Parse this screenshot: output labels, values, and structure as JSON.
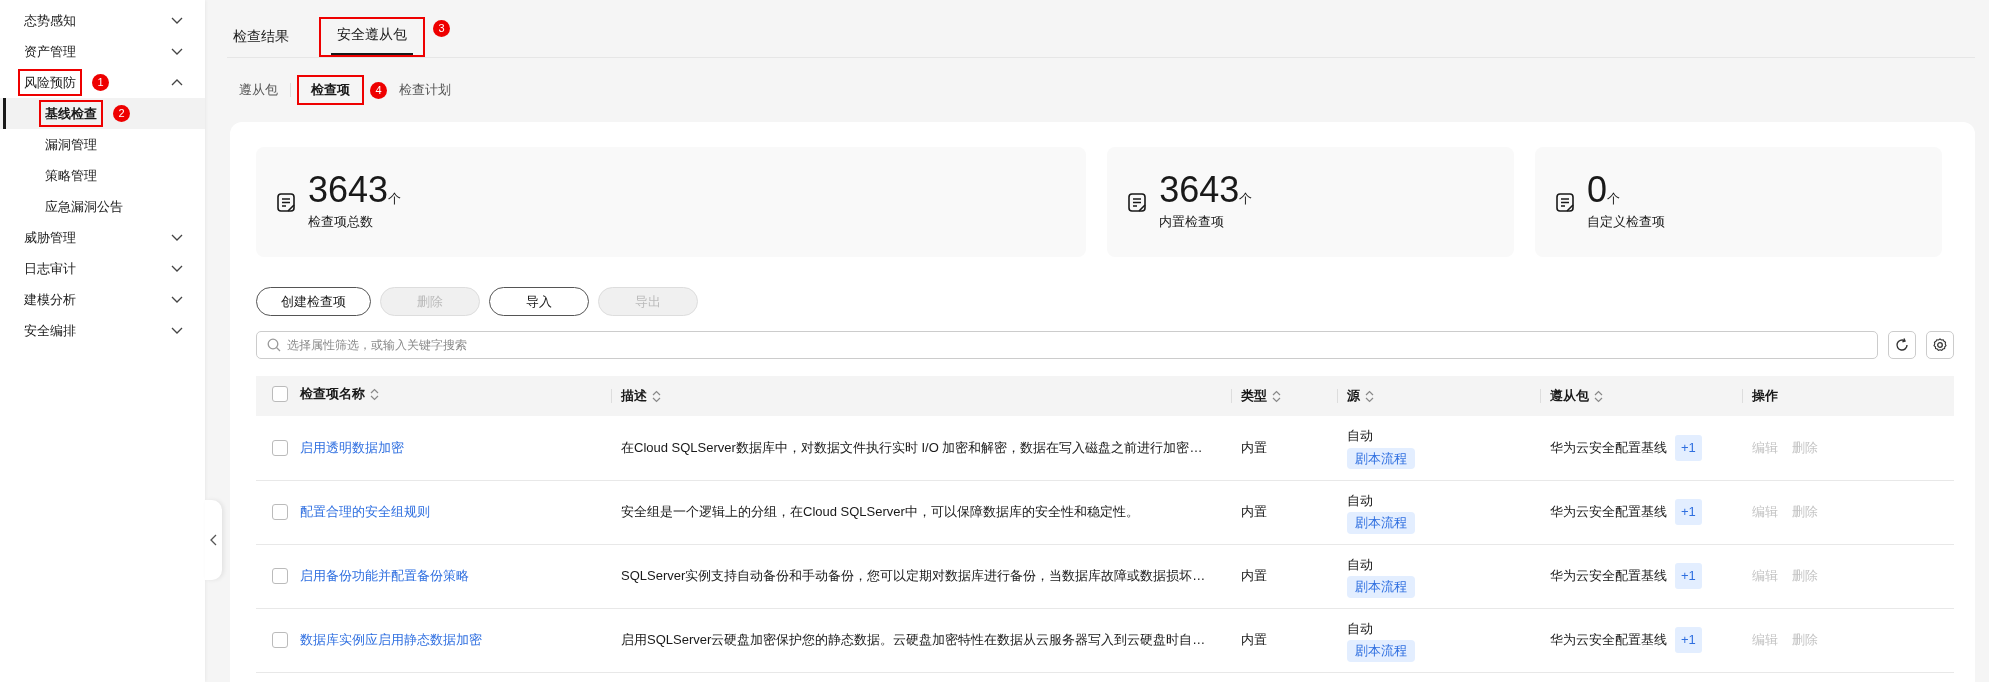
{
  "sidebar": {
    "items": [
      {
        "label": "态势感知",
        "expanded": false
      },
      {
        "label": "资产管理",
        "expanded": false
      },
      {
        "label": "风险预防",
        "expanded": true,
        "annotation": "1",
        "children": [
          {
            "label": "基线检查",
            "selected": true,
            "annotation": "2"
          },
          {
            "label": "漏洞管理",
            "selected": false
          },
          {
            "label": "策略管理",
            "selected": false
          },
          {
            "label": "应急漏洞公告",
            "selected": false
          }
        ]
      },
      {
        "label": "威胁管理",
        "expanded": false
      },
      {
        "label": "日志审计",
        "expanded": false
      },
      {
        "label": "建模分析",
        "expanded": false
      },
      {
        "label": "安全编排",
        "expanded": false
      }
    ]
  },
  "tabs": [
    {
      "label": "检查结果",
      "selected": false
    },
    {
      "label": "安全遵从包",
      "selected": true,
      "annotation": "3"
    }
  ],
  "subtabs": [
    {
      "label": "遵从包",
      "selected": false
    },
    {
      "label": "检查项",
      "selected": true,
      "annotation": "4"
    },
    {
      "label": "检查计划",
      "selected": false
    }
  ],
  "stats": [
    {
      "value": "3643",
      "unit": "个",
      "label": "检查项总数"
    },
    {
      "value": "3643",
      "unit": "个",
      "label": "内置检查项"
    },
    {
      "value": "0",
      "unit": "个",
      "label": "自定义检查项"
    }
  ],
  "toolbar": {
    "buttons": [
      {
        "label": "创建检查项",
        "disabled": false
      },
      {
        "label": "删除",
        "disabled": true
      },
      {
        "label": "导入",
        "disabled": false
      },
      {
        "label": "导出",
        "disabled": true
      }
    ]
  },
  "search": {
    "placeholder": "选择属性筛选，或输入关键字搜索"
  },
  "table": {
    "select_all_checked": false,
    "columns": [
      {
        "label": "检查项名称",
        "sortable": true
      },
      {
        "label": "描述",
        "sortable": true
      },
      {
        "label": "类型",
        "sortable": true
      },
      {
        "label": "源",
        "sortable": true
      },
      {
        "label": "遵从包",
        "sortable": true
      },
      {
        "label": "操作",
        "sortable": false
      }
    ],
    "rows": [
      {
        "checked": false,
        "name": "启用透明数据加密",
        "description": "在Cloud SQLServer数据库中，对数据文件执行实时 I/O 加密和解密，数据在写入磁盘之前进行加密…",
        "type": "内置",
        "source": "自动",
        "source_tag": "剧本流程",
        "package": "华为云安全配置基线",
        "package_more": "+1",
        "actions": [
          {
            "label": "编辑",
            "disabled": true
          },
          {
            "label": "删除",
            "disabled": true
          }
        ]
      },
      {
        "checked": false,
        "name": "配置合理的安全组规则",
        "description": "安全组是一个逻辑上的分组，在Cloud SQLServer中，可以保障数据库的安全性和稳定性。",
        "type": "内置",
        "source": "自动",
        "source_tag": "剧本流程",
        "package": "华为云安全配置基线",
        "package_more": "+1",
        "actions": [
          {
            "label": "编辑",
            "disabled": true
          },
          {
            "label": "删除",
            "disabled": true
          }
        ]
      },
      {
        "checked": false,
        "name": "启用备份功能并配置备份策略",
        "description": "SQLServer实例支持自动备份和手动备份，您可以定期对数据库进行备份，当数据库故障或数据损坏…",
        "type": "内置",
        "source": "自动",
        "source_tag": "剧本流程",
        "package": "华为云安全配置基线",
        "package_more": "+1",
        "actions": [
          {
            "label": "编辑",
            "disabled": true
          },
          {
            "label": "删除",
            "disabled": true
          }
        ]
      },
      {
        "checked": false,
        "name": "数据库实例应启用静态数据加密",
        "description": "启用SQLServer云硬盘加密保护您的静态数据。云硬盘加密特性在数据从云服务器写入到云硬盘时自…",
        "type": "内置",
        "source": "自动",
        "source_tag": "剧本流程",
        "package": "华为云安全配置基线",
        "package_more": "+1",
        "actions": [
          {
            "label": "编辑",
            "disabled": true
          },
          {
            "label": "删除",
            "disabled": true
          }
        ]
      }
    ]
  }
}
